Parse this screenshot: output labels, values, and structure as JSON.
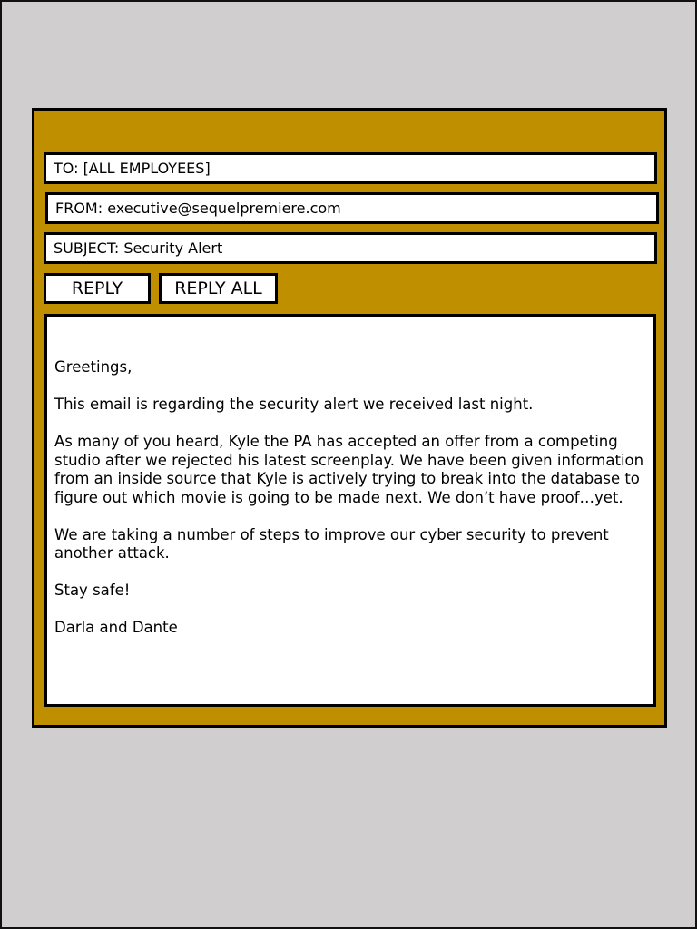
{
  "email": {
    "to": "TO: [ALL EMPLOYEES]",
    "from": "FROM: executive@sequelpremiere.com",
    "subject": "SUBJECT: Security Alert",
    "actions": {
      "reply_label": "REPLY",
      "reply_all_label": "REPLY ALL"
    },
    "body": {
      "greeting": "Greetings,",
      "paragraphs": [
        "This email is regarding the security alert we received last night.",
        "As many of you heard, Kyle the PA has accepted an offer from a competing studio after we rejected his latest screenplay. We have been given information from an inside source that Kyle is actively trying to break into the database to figure out which movie is going to be made next. We don’t have proof…yet.",
        "We are taking a number of steps to improve our cyber security to prevent another attack.",
        "Stay safe!"
      ],
      "signature": "Darla and Dante"
    }
  },
  "colors": {
    "background": "#d0cecf",
    "panel": "#c08f00",
    "field": "#ffffff",
    "border": "#000000"
  }
}
